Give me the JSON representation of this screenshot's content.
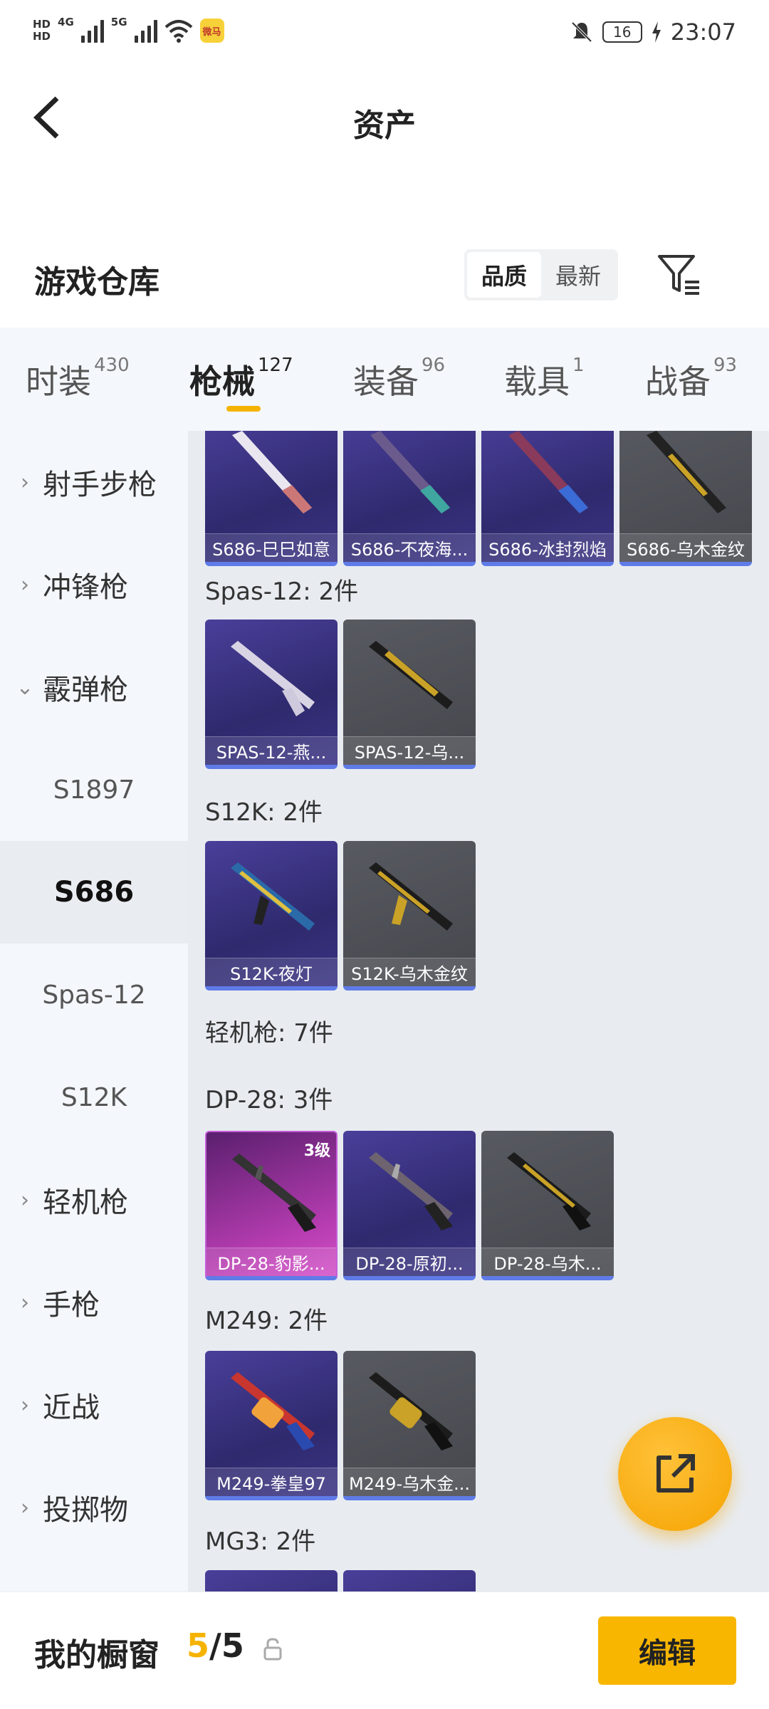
{
  "status_bar": {
    "hd1": "HD",
    "hd2": "HD",
    "net1": "4G",
    "net2": "5G",
    "app_badge": "微马",
    "battery": "16",
    "time": "23:07"
  },
  "header": {
    "title": "资产"
  },
  "warehouse": {
    "title": "游戏仓库",
    "sort_options": [
      "品质",
      "最新"
    ],
    "sort_selected": "品质"
  },
  "tabs": [
    {
      "label": "时装",
      "count": "430"
    },
    {
      "label": "枪械",
      "count": "127",
      "active": true
    },
    {
      "label": "装备",
      "count": "96"
    },
    {
      "label": "载具",
      "count": "1"
    },
    {
      "label": "战备",
      "count": "93"
    }
  ],
  "sidebar": [
    {
      "label": "射手步枪",
      "type": "category",
      "expanded": false
    },
    {
      "label": "冲锋枪",
      "type": "category",
      "expanded": false
    },
    {
      "label": "霰弹枪",
      "type": "category",
      "expanded": true
    },
    {
      "label": "S1897",
      "type": "sub"
    },
    {
      "label": "S686",
      "type": "sub",
      "selected": true
    },
    {
      "label": "Spas-12",
      "type": "sub"
    },
    {
      "label": "S12K",
      "type": "sub"
    },
    {
      "label": "轻机枪",
      "type": "category",
      "expanded": false
    },
    {
      "label": "手枪",
      "type": "category",
      "expanded": false
    },
    {
      "label": "近战",
      "type": "category",
      "expanded": false
    },
    {
      "label": "投掷物",
      "type": "category",
      "expanded": false
    }
  ],
  "content": {
    "s686_items": [
      "S686-巳巳如意",
      "S686-不夜海...",
      "S686-冰封烈焰",
      "S686-乌木金纹"
    ],
    "spas_title": "Spas-12: 2件",
    "spas_items": [
      "SPAS-12-燕...",
      "SPAS-12-乌..."
    ],
    "s12k_title": "S12K: 2件",
    "s12k_items": [
      "S12K-夜灯",
      "S12K-乌木金纹"
    ],
    "lmg_title": "轻机枪: 7件",
    "dp28_title": "DP-28: 3件",
    "dp28_items": [
      "DP-28-豹影...",
      "DP-28-原初...",
      "DP-28-乌木..."
    ],
    "dp28_level": "3级",
    "m249_title": "M249: 2件",
    "m249_items": [
      "M249-拳皇97",
      "M249-乌木金..."
    ],
    "mg3_title": "MG3: 2件"
  },
  "bottom_bar": {
    "label": "我的橱窗",
    "current": "5",
    "separator": "/",
    "total": "5",
    "edit_label": "编辑"
  },
  "colors": {
    "accent": "#f5b300",
    "card_purple": "#3a3383",
    "card_gray": "#4f5157",
    "card_magenta": "#b53cb0",
    "card_underline": "#5f7be8"
  }
}
